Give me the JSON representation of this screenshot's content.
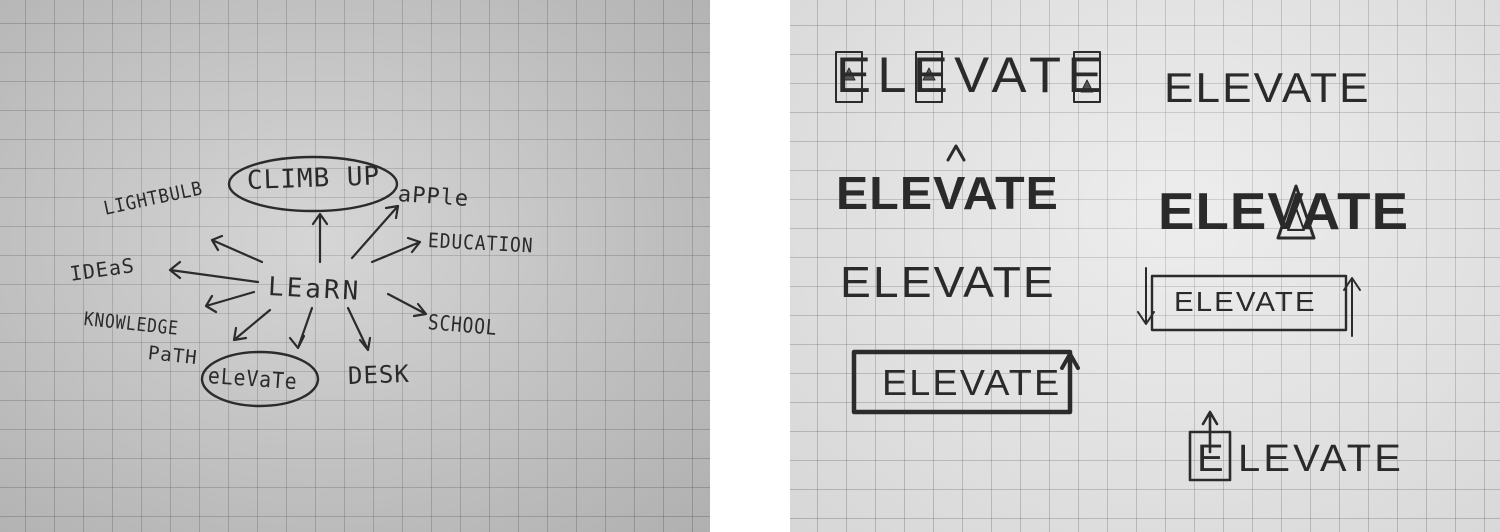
{
  "ink_color": "#2a2a2a",
  "paper_colors": {
    "left": "#c8c8c8",
    "right": "#e4e4e4",
    "grid": "#464646"
  },
  "mind_map": {
    "center": "LEaRN",
    "words": {
      "climb_up": "CLIMB UP",
      "apple": "aPPle",
      "education": "EDUCATION",
      "school": "SCHOOL",
      "desk": "DESK",
      "elevate": "eLeVaTe",
      "path": "PaTH",
      "knowledge": "KNOWLEDGE",
      "ideas": "IDEaS",
      "lightbulb": "LIGHTBULB"
    }
  },
  "logo_sketches": {
    "v1": "ELEVATE",
    "v2": "ELEVATE",
    "v3": "ELEVATE",
    "v4": "ELEVATE",
    "v5": "ELEVATE",
    "v6": "ELEVATE",
    "v7": "ELEVATE",
    "v8_suffix": "LEVATE",
    "v8_boxed_letter": "E"
  }
}
